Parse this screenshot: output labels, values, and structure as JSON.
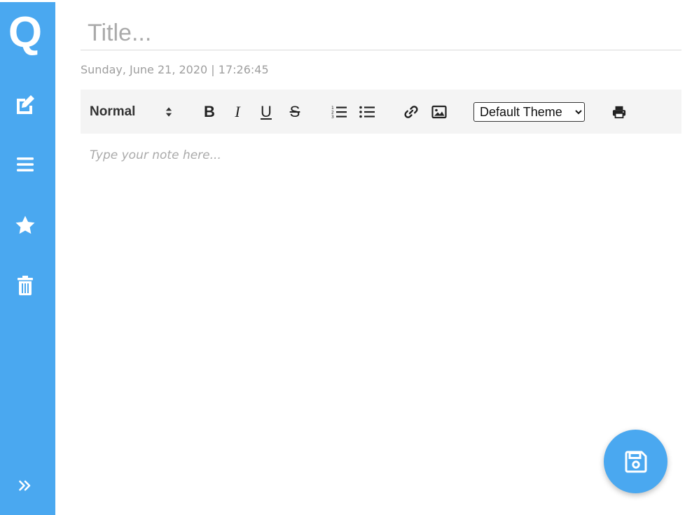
{
  "app": {
    "logo_letter": "Q"
  },
  "colors": {
    "accent": "#4aa8f0",
    "toolbar_bg": "#f4f4f4",
    "placeholder": "#aaaaaa"
  },
  "sidebar": {
    "items": [
      {
        "icon": "edit-icon"
      },
      {
        "icon": "list-icon"
      },
      {
        "icon": "star-icon"
      },
      {
        "icon": "trash-icon"
      }
    ],
    "collapse_icon": "double-chevron-right-icon"
  },
  "note": {
    "title_placeholder": "Title...",
    "timestamp": "Sunday, June 21, 2020 | 17:26:45",
    "body_placeholder": "Type your note here..."
  },
  "toolbar": {
    "format_label": "Normal",
    "bold_label": "B",
    "italic_label": "I",
    "underline_label": "U",
    "strike_label": "S",
    "theme_options": [
      "Default Theme"
    ],
    "theme_selected": "Default Theme"
  },
  "fab": {
    "icon": "save-icon"
  }
}
